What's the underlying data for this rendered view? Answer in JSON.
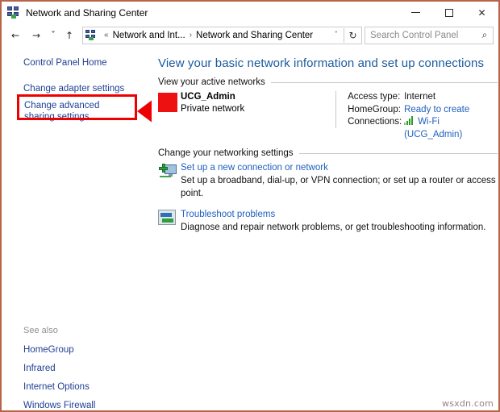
{
  "window": {
    "title": "Network and Sharing Center",
    "app_icon": "network-computers-icon",
    "controls": {
      "minimize": "minimize-icon",
      "maximize": "maximize-icon",
      "close": "close-icon"
    },
    "border_color": "#b5654a"
  },
  "navbar": {
    "back": "←",
    "forward": "→",
    "recent": "ˇ",
    "up": "↑",
    "breadcrumb": {
      "root": "Network and Int...",
      "separator1": "«",
      "separator2": "›",
      "current": "Network and Sharing Center"
    },
    "dropdown_chevron": "ˇ",
    "refresh": "↻",
    "search": {
      "placeholder": "Search Control Panel",
      "icon": "⌕"
    }
  },
  "sidebar": {
    "links": [
      {
        "label": "Control Panel Home"
      },
      {
        "label": "Change adapter settings"
      },
      {
        "label": "Change advanced sharing settings"
      }
    ],
    "see_also_header": "See also",
    "see_also": [
      {
        "label": "HomeGroup"
      },
      {
        "label": "Infrared"
      },
      {
        "label": "Internet Options"
      },
      {
        "label": "Windows Firewall"
      }
    ],
    "highlight_color": "#ee0000",
    "arrow_color": "#ee0000"
  },
  "main": {
    "page_title": "View your basic network information and set up connections",
    "sections": {
      "active_networks": "View your active networks",
      "networking_settings": "Change your networking settings"
    },
    "active_network": {
      "name": "UCG_Admin",
      "type": "Private network",
      "details": [
        {
          "key": "Access type:",
          "value": "Internet",
          "is_link": false
        },
        {
          "key": "HomeGroup:",
          "value": "Ready to create",
          "is_link": true
        },
        {
          "key": "Connections:",
          "value": "Wi-Fi (UCG_Admin)",
          "is_link": true,
          "icon": "wifi-signal-icon"
        }
      ]
    },
    "tasks": [
      {
        "icon": "new-connection-icon",
        "link": "Set up a new connection or network",
        "description": "Set up a broadband, dial-up, or VPN connection; or set up a router or access point."
      },
      {
        "icon": "troubleshoot-icon",
        "link": "Troubleshoot problems",
        "description": "Diagnose and repair network problems, or get troubleshooting information."
      }
    ]
  },
  "watermark": "wsxdn.com"
}
